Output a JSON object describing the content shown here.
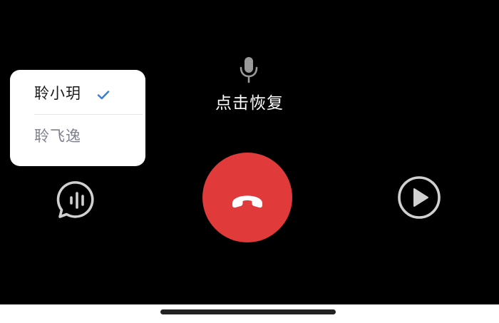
{
  "voice_menu": {
    "options": [
      {
        "label": "聆小玥",
        "selected": true
      },
      {
        "label": "聆飞逸",
        "selected": false
      }
    ],
    "check_color": "#3a7bd5"
  },
  "status": {
    "resume_label": "点击恢复",
    "mic_state": "muted"
  },
  "controls": {
    "subtitle_icon": "speech-bubble-waveform-icon",
    "hangup_icon": "phone-hangup-icon",
    "play_icon": "play-circle-icon",
    "hangup_color": "#e03a3a"
  },
  "colors": {
    "background": "#000000",
    "popup": "#ffffff",
    "selected_text": "#1a1a1a",
    "unselected_text": "#7d7f8d",
    "control_icon": "#d0d0d0"
  }
}
